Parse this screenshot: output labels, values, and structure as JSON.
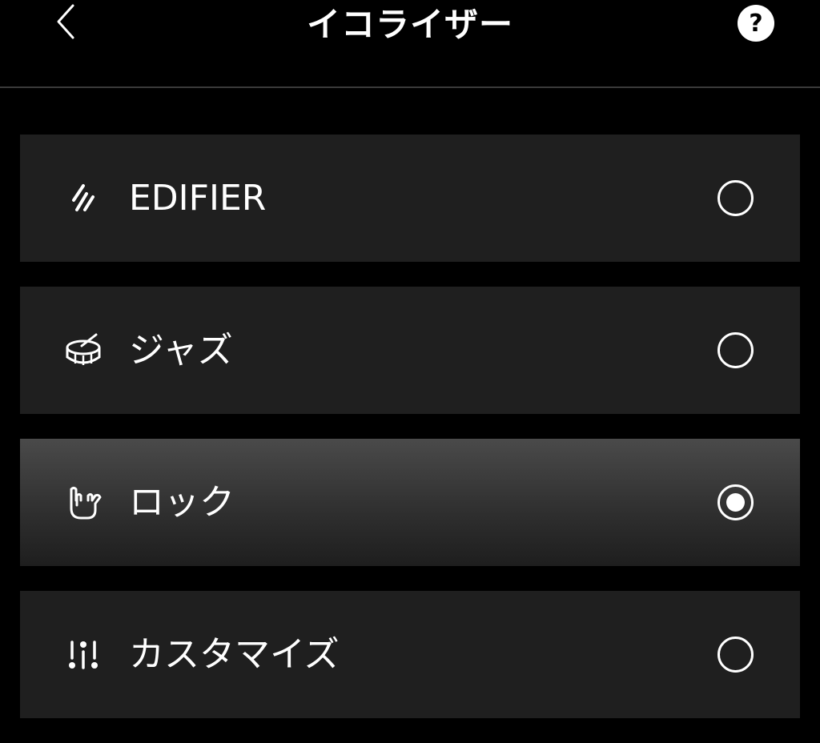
{
  "header": {
    "title": "イコライザー",
    "back_icon": "chevron-left-icon",
    "help_label": "?",
    "help_icon": "help-circle-icon"
  },
  "presets": [
    {
      "label": "EDIFIER",
      "icon": "edifier-logo-icon",
      "selected": false
    },
    {
      "label": "ジャズ",
      "icon": "drum-icon",
      "selected": false
    },
    {
      "label": "ロック",
      "icon": "rock-hand-icon",
      "selected": true
    },
    {
      "label": "カスタマイズ",
      "icon": "sliders-icon",
      "selected": false
    }
  ],
  "colors": {
    "background": "#000000",
    "item_background": "#1f1f1f",
    "selected_item_top": "#4a4a4a",
    "text": "#ffffff",
    "divider": "#3a3a3a"
  }
}
